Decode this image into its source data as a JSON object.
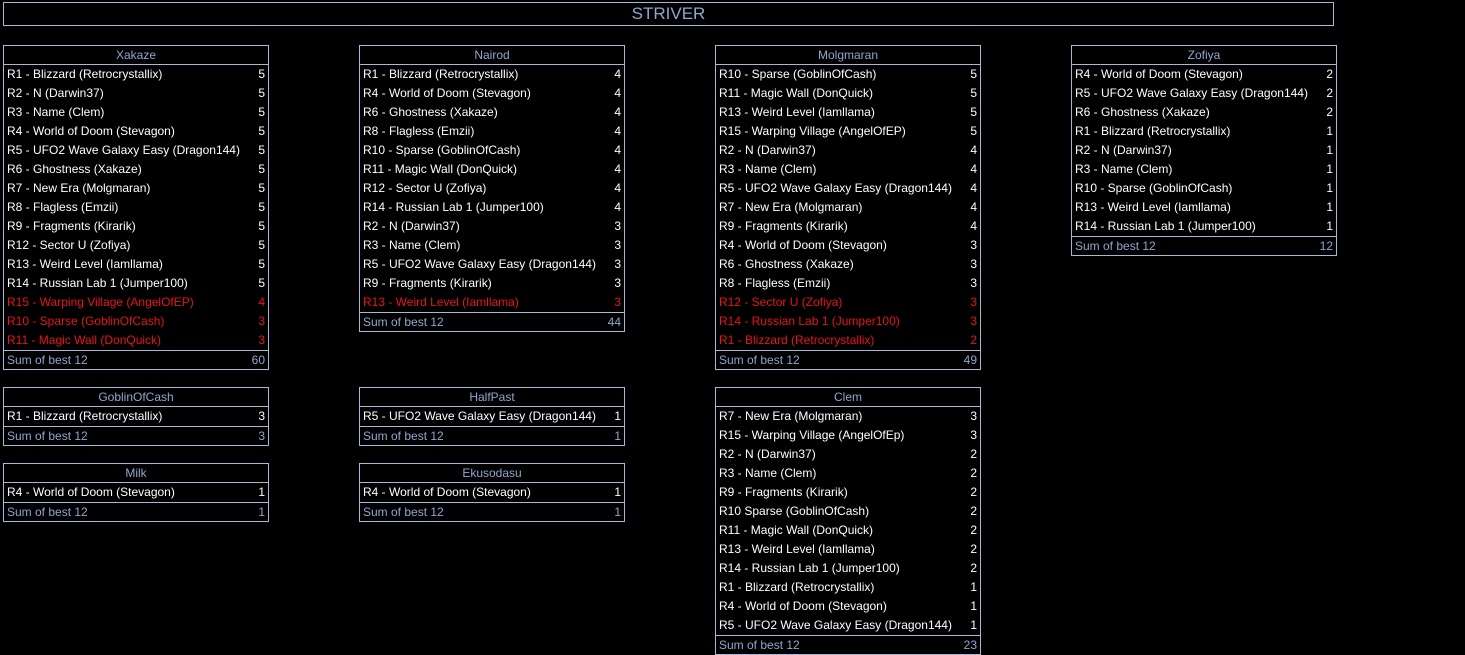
{
  "title": "STRIVER",
  "colors": {
    "background": "#000000",
    "border": "#aab8d8",
    "header_text": "#8fa6cf",
    "row_text": "#ffffff",
    "dropped_text": "#e8141b"
  },
  "sum_label": "Sum of best 12",
  "panels": [
    {
      "player": "Xakaze",
      "sum": "60",
      "rows": [
        {
          "level": "R1 - Blizzard (Retrocrystallix)",
          "score": "5",
          "dropped": false
        },
        {
          "level": "R2 - N (Darwin37)",
          "score": "5",
          "dropped": false
        },
        {
          "level": "R3 - Name (Clem)",
          "score": "5",
          "dropped": false
        },
        {
          "level": "R4 - World of Doom (Stevagon)",
          "score": "5",
          "dropped": false
        },
        {
          "level": "R5 - UFO2 Wave Galaxy Easy (Dragon144)",
          "score": "5",
          "dropped": false
        },
        {
          "level": "R6 - Ghostness (Xakaze)",
          "score": "5",
          "dropped": false
        },
        {
          "level": "R7 - New Era (Molgmaran)",
          "score": "5",
          "dropped": false
        },
        {
          "level": "R8 - Flagless (Emzii)",
          "score": "5",
          "dropped": false
        },
        {
          "level": "R9 - Fragments (Kirarik)",
          "score": "5",
          "dropped": false
        },
        {
          "level": "R12 - Sector U (Zofiya)",
          "score": "5",
          "dropped": false
        },
        {
          "level": "R13 - Weird Level (Iamllama)",
          "score": "5",
          "dropped": false
        },
        {
          "level": "R14 - Russian Lab 1 (Jumper100)",
          "score": "5",
          "dropped": false
        },
        {
          "level": "R15 - Warping Village (AngelOfEP)",
          "score": "4",
          "dropped": true
        },
        {
          "level": "R10 - Sparse (GoblinOfCash)",
          "score": "3",
          "dropped": true
        },
        {
          "level": "R11 - Magic Wall (DonQuick)",
          "score": "3",
          "dropped": true
        }
      ]
    },
    {
      "player": "Nairod",
      "sum": "44",
      "rows": [
        {
          "level": "R1 - Blizzard (Retrocrystallix)",
          "score": "4",
          "dropped": false
        },
        {
          "level": "R4 - World of Doom (Stevagon)",
          "score": "4",
          "dropped": false
        },
        {
          "level": "R6 - Ghostness (Xakaze)",
          "score": "4",
          "dropped": false
        },
        {
          "level": "R8 - Flagless (Emzii)",
          "score": "4",
          "dropped": false
        },
        {
          "level": "R10 - Sparse (GoblinOfCash)",
          "score": "4",
          "dropped": false
        },
        {
          "level": "R11 - Magic Wall (DonQuick)",
          "score": "4",
          "dropped": false
        },
        {
          "level": "R12 - Sector U (Zofiya)",
          "score": "4",
          "dropped": false
        },
        {
          "level": "R14 - Russian Lab 1 (Jumper100)",
          "score": "4",
          "dropped": false
        },
        {
          "level": "R2 - N (Darwin37)",
          "score": "3",
          "dropped": false
        },
        {
          "level": "R3 - Name (Clem)",
          "score": "3",
          "dropped": false
        },
        {
          "level": "R5 - UFO2 Wave Galaxy Easy (Dragon144)",
          "score": "3",
          "dropped": false
        },
        {
          "level": "R9 - Fragments (Kirarik)",
          "score": "3",
          "dropped": false
        },
        {
          "level": "R13 - Weird Level (Iamllama)",
          "score": "3",
          "dropped": true
        }
      ]
    },
    {
      "player": "Molgmaran",
      "sum": "49",
      "rows": [
        {
          "level": "R10 - Sparse (GoblinOfCash)",
          "score": "5",
          "dropped": false
        },
        {
          "level": "R11 - Magic Wall (DonQuick)",
          "score": "5",
          "dropped": false
        },
        {
          "level": "R13 - Weird Level (Iamllama)",
          "score": "5",
          "dropped": false
        },
        {
          "level": "R15 - Warping Village (AngelOfEP)",
          "score": "5",
          "dropped": false
        },
        {
          "level": "R2 - N (Darwin37)",
          "score": "4",
          "dropped": false
        },
        {
          "level": "R3 - Name (Clem)",
          "score": "4",
          "dropped": false
        },
        {
          "level": "R5 - UFO2 Wave Galaxy Easy (Dragon144)",
          "score": "4",
          "dropped": false
        },
        {
          "level": "R7 - New Era (Molgmaran)",
          "score": "4",
          "dropped": false
        },
        {
          "level": "R9 - Fragments (Kirarik)",
          "score": "4",
          "dropped": false
        },
        {
          "level": "R4 - World of Doom (Stevagon)",
          "score": "3",
          "dropped": false
        },
        {
          "level": "R6 - Ghostness (Xakaze)",
          "score": "3",
          "dropped": false
        },
        {
          "level": "R8 - Flagless (Emzii)",
          "score": "3",
          "dropped": false
        },
        {
          "level": "R12 - Sector U (Zofiya)",
          "score": "3",
          "dropped": true
        },
        {
          "level": "R14 - Russian Lab 1 (Jumper100)",
          "score": "3",
          "dropped": true
        },
        {
          "level": "R1 - Blizzard (Retrocrystallix)",
          "score": "2",
          "dropped": true
        }
      ]
    },
    {
      "player": "Zofiya",
      "sum": "12",
      "rows": [
        {
          "level": "R4 - World of Doom (Stevagon)",
          "score": "2",
          "dropped": false
        },
        {
          "level": "R5 - UFO2 Wave Galaxy Easy (Dragon144)",
          "score": "2",
          "dropped": false
        },
        {
          "level": "R6 - Ghostness (Xakaze)",
          "score": "2",
          "dropped": false
        },
        {
          "level": "R1 - Blizzard (Retrocrystallix)",
          "score": "1",
          "dropped": false
        },
        {
          "level": "R2 - N (Darwin37)",
          "score": "1",
          "dropped": false
        },
        {
          "level": "R3 - Name (Clem)",
          "score": "1",
          "dropped": false
        },
        {
          "level": "R10 - Sparse (GoblinOfCash)",
          "score": "1",
          "dropped": false
        },
        {
          "level": "R13 - Weird Level (Iamllama)",
          "score": "1",
          "dropped": false
        },
        {
          "level": "R14 - Russian Lab 1 (Jumper100)",
          "score": "1",
          "dropped": false
        }
      ]
    },
    {
      "player": "GoblinOfCash",
      "sum": "3",
      "rows": [
        {
          "level": "R1 - Blizzard (Retrocrystallix)",
          "score": "3",
          "dropped": false
        }
      ]
    },
    {
      "player": "HalfPast",
      "sum": "1",
      "rows": [
        {
          "level": "R5 - UFO2 Wave Galaxy Easy (Dragon144)",
          "score": "1",
          "dropped": false
        }
      ]
    },
    {
      "player": "Clem",
      "sum": "23",
      "rows": [
        {
          "level": "R7 - New Era (Molgmaran)",
          "score": "3",
          "dropped": false
        },
        {
          "level": "R15 - Warping Village (AngelOfEp)",
          "score": "3",
          "dropped": false
        },
        {
          "level": "R2 - N (Darwin37)",
          "score": "2",
          "dropped": false
        },
        {
          "level": "R3 - Name (Clem)",
          "score": "2",
          "dropped": false
        },
        {
          "level": "R9 - Fragments (Kirarik)",
          "score": "2",
          "dropped": false
        },
        {
          "level": "R10  Sparse (GoblinOfCash)",
          "score": "2",
          "dropped": false
        },
        {
          "level": "R11 - Magic Wall (DonQuick)",
          "score": "2",
          "dropped": false
        },
        {
          "level": "R13 - Weird Level (Iamllama)",
          "score": "2",
          "dropped": false
        },
        {
          "level": "R14 - Russian Lab 1 (Jumper100)",
          "score": "2",
          "dropped": false
        },
        {
          "level": "R1 - Blizzard (Retrocrystallix)",
          "score": "1",
          "dropped": false
        },
        {
          "level": "R4 - World of Doom (Stevagon)",
          "score": "1",
          "dropped": false
        },
        {
          "level": "R5 - UFO2 Wave Galaxy Easy (Dragon144)",
          "score": "1",
          "dropped": false
        }
      ]
    },
    {
      "player": "Milk",
      "sum": "1",
      "rows": [
        {
          "level": "R4 - World of Doom (Stevagon)",
          "score": "1",
          "dropped": false
        }
      ]
    },
    {
      "player": "Ekusodasu",
      "sum": "1",
      "rows": [
        {
          "level": "R4 - World of Doom (Stevagon)",
          "score": "1",
          "dropped": false
        }
      ]
    }
  ]
}
